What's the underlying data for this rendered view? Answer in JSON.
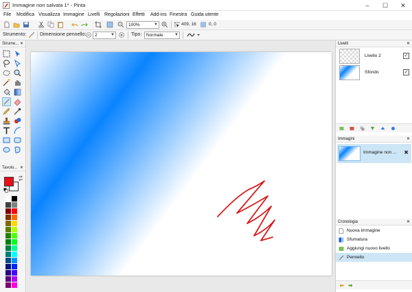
{
  "window": {
    "title": "Immagine non salvata 1* - Pinta",
    "controls": [
      "–",
      "☐",
      "✕"
    ]
  },
  "menu": [
    "File",
    "Modifica",
    "Visualizza",
    "Immagine",
    "Livelli",
    "Regolazioni",
    "Effetti",
    "Add-ins",
    "Finestra",
    "Guida utente"
  ],
  "toolbar": {
    "zoom": "100%",
    "cursor_pos": "409, 16",
    "selection_size": "0, 0"
  },
  "tool_options": {
    "tool_label": "Strumento:",
    "brush_size_label": "Dimensione pennello:",
    "brush_size": "2",
    "type_label": "Tipo:",
    "type_value": "Normale"
  },
  "tools_panel": {
    "title": "Strume...",
    "pin": "✕"
  },
  "colors_panel": {
    "title": "Tavolo...",
    "pin": "✕",
    "primary": "#e8101a",
    "secondary": "#ffffff"
  },
  "palette": [
    "#ffffff",
    "#000000",
    "#404040",
    "#808080",
    "#7f0000",
    "#ff0000",
    "#7f3300",
    "#ff6a00",
    "#7f6a00",
    "#ffd800",
    "#5b7f00",
    "#b6ff00",
    "#267f00",
    "#4cff00",
    "#007f0e",
    "#00ff21",
    "#007f46",
    "#00ff90",
    "#007f7f",
    "#00ffff",
    "#004a7f",
    "#0094ff",
    "#00137f",
    "#0026ff",
    "#21007f",
    "#4800ff",
    "#57007f",
    "#b200ff",
    "#7f006e",
    "#ff00dc"
  ],
  "layers_panel": {
    "title": "Livelli",
    "pin": "✕",
    "layers": [
      {
        "name": "Livello 2",
        "visible": "✓"
      },
      {
        "name": "Sfondo",
        "visible": "✓"
      }
    ]
  },
  "images_panel": {
    "title": "Immagini",
    "pin": "✕",
    "item": "Immagine non ...",
    "close": "✖"
  },
  "history_panel": {
    "title": "Cronologia",
    "pin": "✕",
    "items": [
      {
        "name": "Nuova immagine"
      },
      {
        "name": "Sfumatura"
      },
      {
        "name": "Aggiungi nuovo livello"
      },
      {
        "name": "Pennello"
      }
    ]
  },
  "colors": {
    "accent": "#0a84ff",
    "stroke": "#d41a1a",
    "selection": "#cde6f7"
  }
}
